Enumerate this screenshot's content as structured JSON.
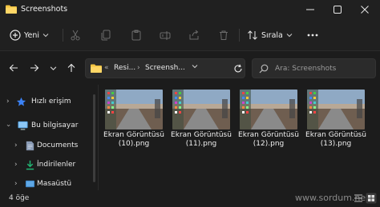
{
  "window": {
    "title": "Screenshots",
    "minimize_icon": "minimize-icon",
    "maximize_icon": "maximize-icon",
    "close_icon": "close-icon"
  },
  "toolbar": {
    "new_label": "Yeni",
    "sort_label": "Sırala",
    "icons": [
      "cut-icon",
      "copy-icon",
      "paste-icon",
      "rename-icon",
      "share-icon",
      "delete-icon",
      "more-icon"
    ]
  },
  "navigation": {
    "back_icon": "back-arrow-icon",
    "forward_icon": "forward-arrow-icon",
    "history_icon": "chevron-down-icon",
    "up_icon": "up-arrow-icon",
    "address": {
      "overflow": "«",
      "crumb1": "Resi...",
      "crumb2": "Screensh...",
      "separator": "›"
    },
    "search_placeholder": "Ara: Screenshots"
  },
  "sidebar": {
    "items": [
      {
        "label": "Hızlı erişim",
        "icon": "star-icon"
      },
      {
        "label": "Bu bilgisayar",
        "icon": "computer-icon"
      },
      {
        "label": "Documents",
        "icon": "document-icon"
      },
      {
        "label": "İndirilenler",
        "icon": "download-icon"
      },
      {
        "label": "Masaüstü",
        "icon": "desktop-icon"
      }
    ]
  },
  "files": [
    {
      "name_line1": "Ekran Görüntüsü",
      "name_line2": "(10).png"
    },
    {
      "name_line1": "Ekran Görüntüsü",
      "name_line2": "(11).png"
    },
    {
      "name_line1": "Ekran Görüntüsü",
      "name_line2": "(12).png"
    },
    {
      "name_line1": "Ekran Görüntüsü",
      "name_line2": "(13).png"
    }
  ],
  "status": {
    "item_count": "4 öğe",
    "watermark": "www.sordum.net"
  },
  "colors": {
    "background": "#1c1c1c",
    "titlebar": "#202020",
    "folder": "#f5c542",
    "accent": "#60a5fa"
  }
}
